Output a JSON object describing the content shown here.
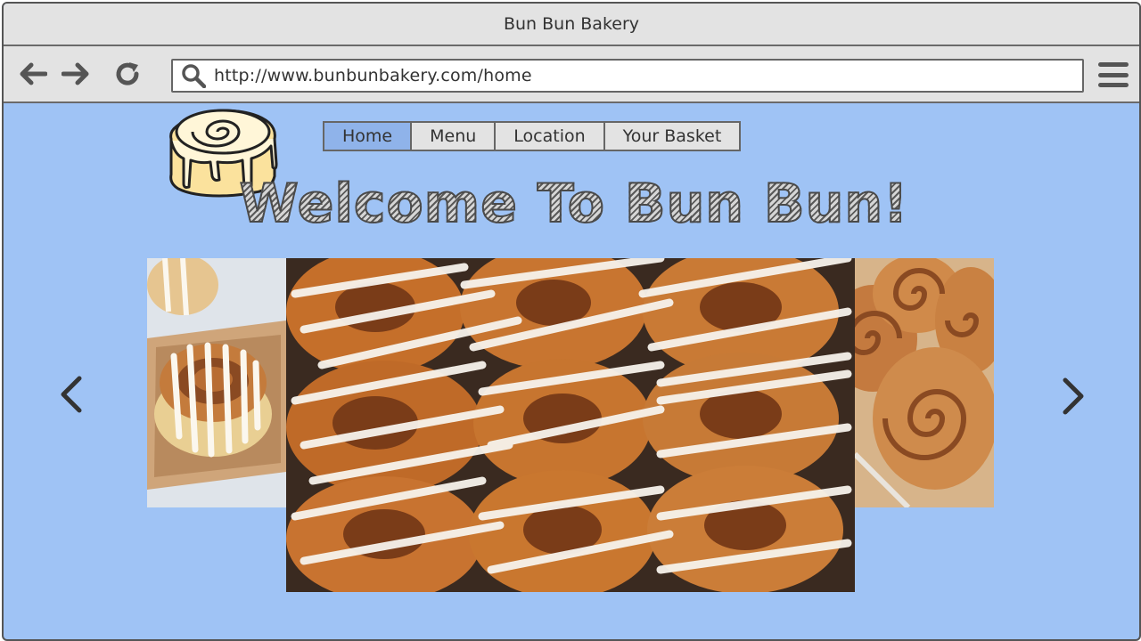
{
  "browser": {
    "title": "Bun Bun Bakery",
    "url": "http://www.bunbunbakery.com/home",
    "icons": [
      "back-icon",
      "forward-icon",
      "refresh-icon",
      "search-icon",
      "menu-icon"
    ]
  },
  "nav": {
    "tabs": [
      {
        "label": "Home",
        "active": true
      },
      {
        "label": "Menu",
        "active": false
      },
      {
        "label": "Location",
        "active": false
      },
      {
        "label": "Your Basket",
        "active": false
      }
    ]
  },
  "hero": {
    "heading": "Welcome To Bun Bun!"
  },
  "carousel": {
    "prev_icon": "chevron-left-icon",
    "next_icon": "chevron-right-icon",
    "images": [
      "cinnamon-roll-single",
      "cinnamon-rolls-tray",
      "cinnamon-rolls-pan"
    ]
  },
  "colors": {
    "page_bg": "#9fc3f5",
    "chrome_bg": "#e3e3e3",
    "active_tab": "#8fb3ea"
  }
}
